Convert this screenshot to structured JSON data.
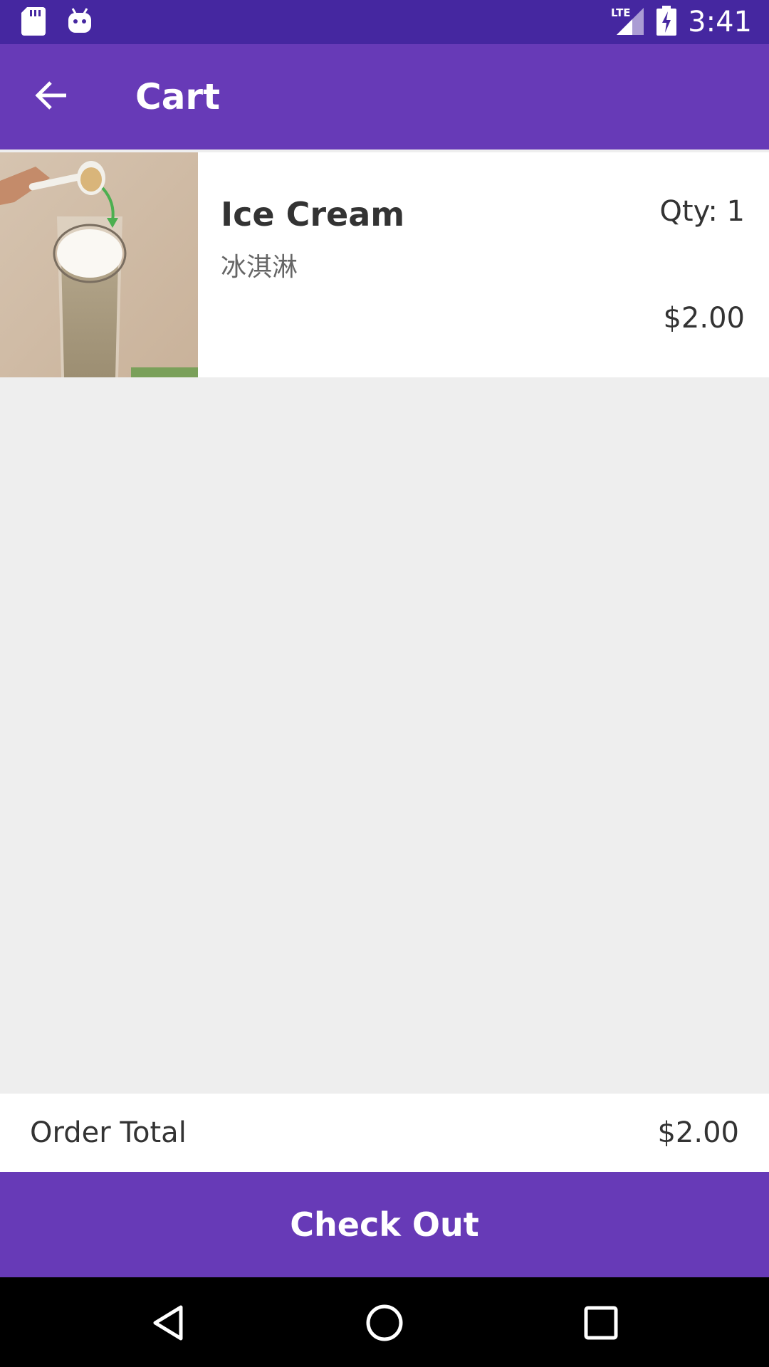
{
  "status_bar": {
    "time": "3:41",
    "network": "LTE",
    "icons": [
      "sd-card-icon",
      "android-debug-icon",
      "lte-signal-icon",
      "battery-charging-icon"
    ]
  },
  "app_bar": {
    "title": "Cart",
    "back_icon": "arrow-back-icon"
  },
  "cart": {
    "items": [
      {
        "name": "Ice Cream",
        "subname": "冰淇淋",
        "qty_label": "Qty: 1",
        "price": "$2.00"
      }
    ]
  },
  "order": {
    "total_label": "Order Total",
    "total_value": "$2.00"
  },
  "checkout": {
    "label": "Check Out"
  },
  "colors": {
    "status_bar": "#4527a0",
    "primary": "#673ab7",
    "background": "#eeeeee"
  }
}
